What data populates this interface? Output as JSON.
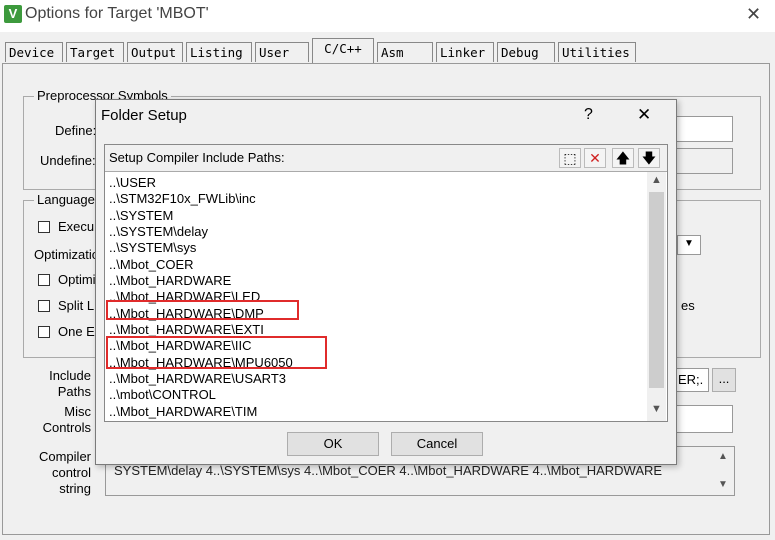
{
  "window": {
    "title": "Options for Target 'MBOT'",
    "icon_glyph": "V",
    "close_glyph": "✕"
  },
  "tabs": [
    {
      "label": "Device",
      "active": false
    },
    {
      "label": "Target",
      "active": false
    },
    {
      "label": "Output",
      "active": false
    },
    {
      "label": "Listing",
      "active": false
    },
    {
      "label": "User",
      "active": false
    },
    {
      "label": "C/C++",
      "active": true
    },
    {
      "label": "Asm",
      "active": false
    },
    {
      "label": "Linker",
      "active": false
    },
    {
      "label": "Debug",
      "active": false
    },
    {
      "label": "Utilities",
      "active": false
    }
  ],
  "background": {
    "preprocessor_title": "Preprocessor Symbols",
    "define_label": "Define:",
    "undefine_label": "Undefine:",
    "language_title": "Language",
    "execute_label": "Execu",
    "optimization_label": "Optimizatio",
    "optimize_label": "Optimi",
    "split_label": "Split L",
    "one_label": "One E",
    "ies_text": "es",
    "include_label": "Include",
    "paths_label": "Paths",
    "misc_label": "Misc",
    "controls_label": "Controls",
    "compiler_label": "Compiler",
    "control_label": "control",
    "string_label": "string",
    "include_paths_tail": "ER;.",
    "browse_label": "...",
    "compiler_string_text": "SYSTEM\\delay 4..\\SYSTEM\\sys 4..\\Mbot_COER 4..\\Mbot_HARDWARE 4..\\Mbot_HARDWARE"
  },
  "dialog": {
    "title": "Folder Setup",
    "help_glyph": "?",
    "close_glyph": "✕",
    "list_header": "Setup Compiler Include Paths:",
    "toolbar": [
      {
        "name": "new-folder-icon",
        "glyph": "⬚"
      },
      {
        "name": "delete-icon",
        "glyph": "✕",
        "color": "#d02020"
      },
      {
        "name": "move-up-icon",
        "glyph": "🡅"
      },
      {
        "name": "move-down-icon",
        "glyph": "🡇"
      }
    ],
    "paths": [
      "..\\USER",
      "..\\STM32F10x_FWLib\\inc",
      "..\\SYSTEM",
      "..\\SYSTEM\\delay",
      "..\\SYSTEM\\sys",
      "..\\Mbot_COER",
      "..\\Mbot_HARDWARE",
      "..\\Mbot_HARDWARE\\LED",
      "..\\Mbot_HARDWARE\\DMP",
      "..\\Mbot_HARDWARE\\EXTI",
      "..\\Mbot_HARDWARE\\IIC",
      "..\\Mbot_HARDWARE\\MPU6050",
      "..\\Mbot_HARDWARE\\USART3",
      "..\\mbot\\CONTROL",
      "..\\Mbot_HARDWARE\\TIM"
    ],
    "highlighted_paths": [
      "..\\Mbot_HARDWARE\\DMP",
      "..\\Mbot_HARDWARE\\IIC",
      "..\\Mbot_HARDWARE\\MPU6050"
    ],
    "highlight_color": "#e02b2b",
    "ok_label": "OK",
    "cancel_label": "Cancel"
  }
}
